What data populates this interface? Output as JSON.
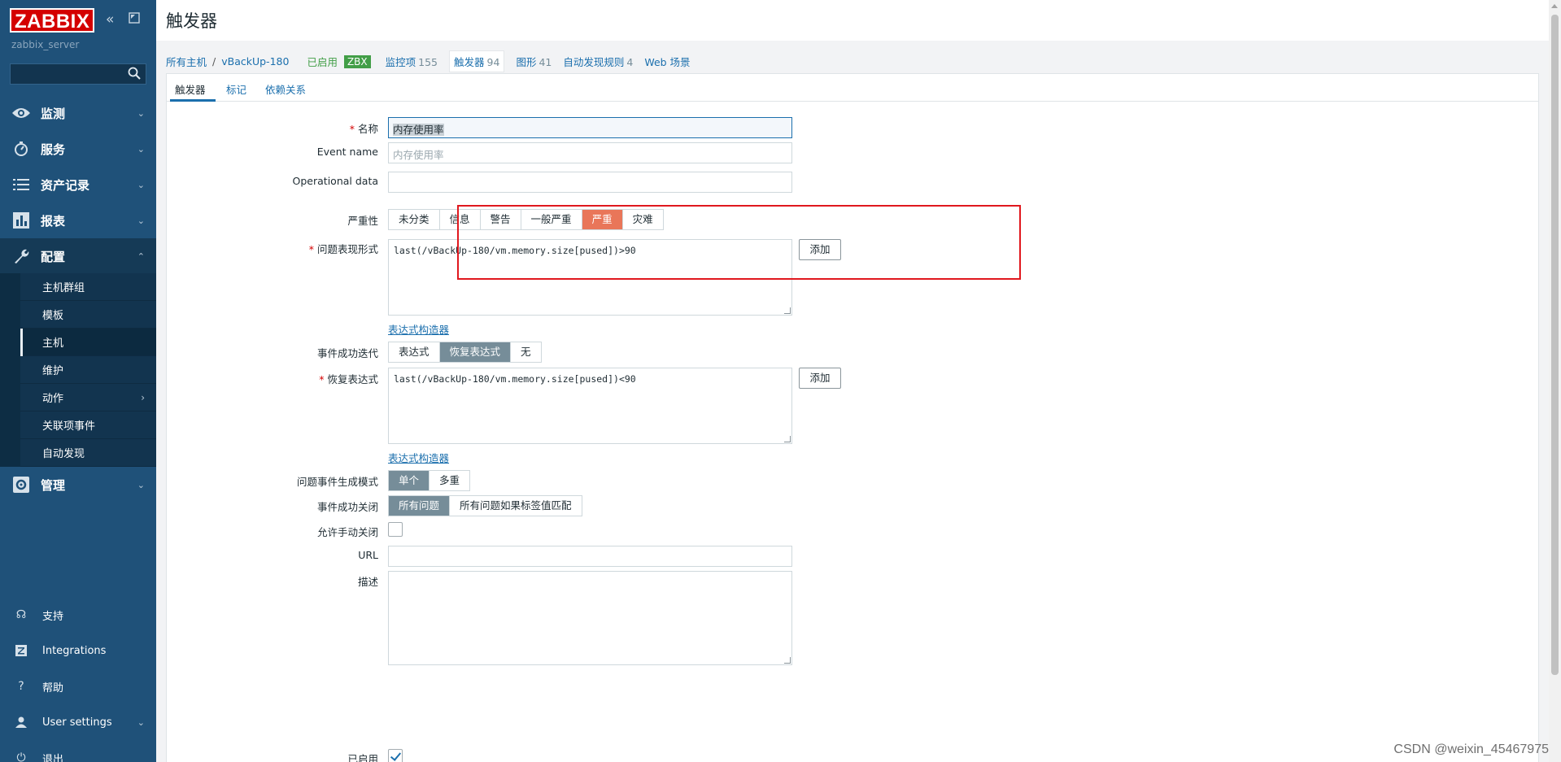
{
  "sidebar": {
    "logo": "ZABBIX",
    "server": "zabbix_server",
    "nav": [
      {
        "label": "监测"
      },
      {
        "label": "服务"
      },
      {
        "label": "资产记录"
      },
      {
        "label": "报表"
      },
      {
        "label": "配置"
      }
    ],
    "config_sub": [
      "主机群组",
      "模板",
      "主机",
      "维护",
      "动作",
      "关联项事件",
      "自动发现"
    ],
    "admin": "管理",
    "footer": [
      "支持",
      "Integrations",
      "帮助",
      "User settings",
      "退出"
    ]
  },
  "header": {
    "title": "触发器"
  },
  "breadcrumb": {
    "all_hosts": "所有主机",
    "sep": "/",
    "host": "vBackUp-180",
    "status": "已启用",
    "zbx": "ZBX",
    "items_label": "监控项",
    "items_count": "155",
    "triggers_label": "触发器",
    "triggers_count": "94",
    "graphs_label": "图形",
    "graphs_count": "41",
    "discovery_label": "自动发现规则",
    "discovery_count": "4",
    "web_label": "Web 场景"
  },
  "tabs": [
    "触发器",
    "标记",
    "依赖关系"
  ],
  "form": {
    "name_label": "名称",
    "name_value": "内存使用率",
    "event_name_label": "Event name",
    "event_name_placeholder": "内存使用率",
    "opdata_label": "Operational data",
    "severity_label": "严重性",
    "severity_options": [
      "未分类",
      "信息",
      "警告",
      "一般严重",
      "严重",
      "灾难"
    ],
    "severity_selected": "严重",
    "problem_expr_label": "问题表现形式",
    "problem_expr": "last(/vBackUp-180/vm.memory.size[pused])>90",
    "add_label": "添加",
    "expr_builder": "表达式构造器",
    "ok_event_label": "事件成功迭代",
    "ok_event_options": [
      "表达式",
      "恢复表达式",
      "无"
    ],
    "ok_event_selected": "恢复表达式",
    "recovery_expr_label": "恢复表达式",
    "recovery_expr": "last(/vBackUp-180/vm.memory.size[pused])<90",
    "gen_mode_label": "问题事件生成模式",
    "gen_mode_options": [
      "单个",
      "多重"
    ],
    "gen_mode_selected": "单个",
    "ok_close_label": "事件成功关闭",
    "ok_close_options": [
      "所有问题",
      "所有问题如果标签值匹配"
    ],
    "ok_close_selected": "所有问题",
    "manual_close_label": "允许手动关闭",
    "manual_close": false,
    "url_label": "URL",
    "desc_label": "描述",
    "enabled_label": "已启用",
    "enabled": true
  },
  "watermark": "CSDN @weixin_45467975"
}
